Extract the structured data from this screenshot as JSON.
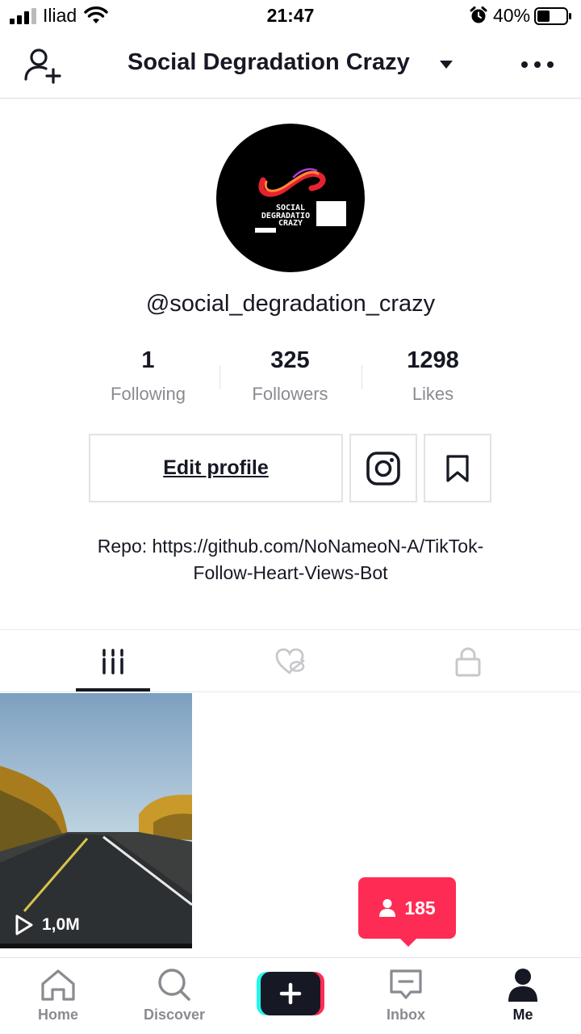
{
  "status_bar": {
    "carrier": "Iliad",
    "time": "21:47",
    "battery": "40%"
  },
  "header": {
    "title": "Social Degradation Crazy"
  },
  "profile": {
    "avatar_text": [
      "SOCIAL",
      "DEGRADATIO",
      "CRAZY"
    ],
    "username": "@social_degradation_crazy",
    "stats": [
      {
        "value": "1",
        "label": "Following"
      },
      {
        "value": "325",
        "label": "Followers"
      },
      {
        "value": "1298",
        "label": "Likes"
      }
    ],
    "edit_profile_label": "Edit profile",
    "bio_line1": "Repo: https://github.com/NoNameoN-A/TikTok-",
    "bio_line2": "Follow-Heart-Views-Bot"
  },
  "videos": [
    {
      "views": "1,0M"
    }
  ],
  "toast": {
    "new_followers": "185"
  },
  "bottom_nav": {
    "home": "Home",
    "discover": "Discover",
    "inbox": "Inbox",
    "me": "Me"
  },
  "colors": {
    "accent": "#fe2c55",
    "text": "#161823",
    "muted": "#8a8b91",
    "create_cyan": "#25f4ee"
  }
}
